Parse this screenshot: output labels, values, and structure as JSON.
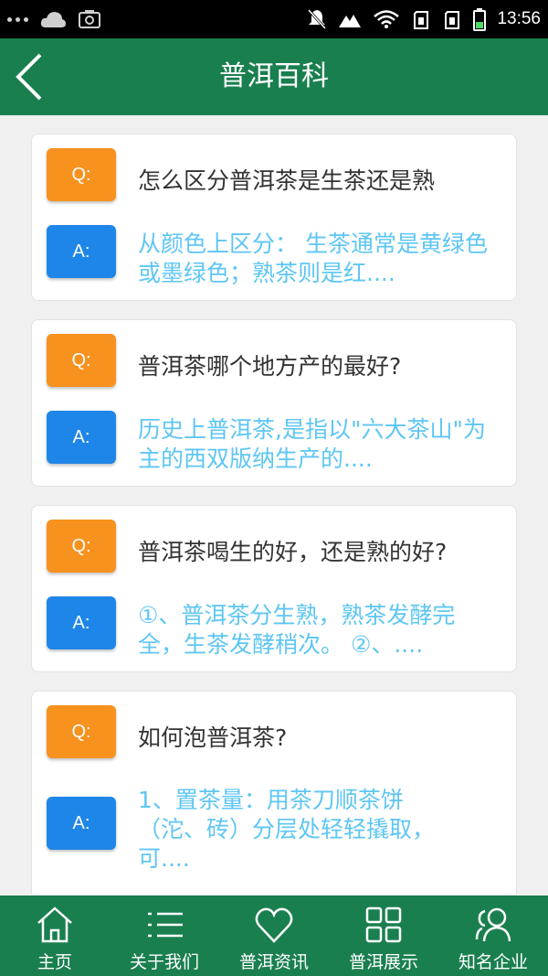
{
  "status_bar": {
    "time": "13:56",
    "icons": [
      "dots-icon",
      "cloud-icon",
      "screenshot-icon",
      "mute-icon",
      "signal-icon",
      "wifi-icon",
      "sim1-icon",
      "sim2-icon",
      "battery-icon"
    ]
  },
  "header": {
    "title": "普洱百科",
    "back_icon": "back-arrow-icon"
  },
  "qa": {
    "q_badge": "Q:",
    "a_badge": "A:",
    "items": [
      {
        "question": "怎么区分普洱茶是生茶还是熟",
        "answer": "从颜色上区分： 生茶通常是黄绿色或墨绿色；熟茶则是红...."
      },
      {
        "question": "普洱茶哪个地方产的最好?",
        "answer": "历史上普洱茶,是指以\"六大茶山\"为主的西双版纳生产的...."
      },
      {
        "question": "普洱茶喝生的好，还是熟的好?",
        "answer": "①、普洱茶分生熟，熟茶发酵完全，生茶发酵稍次。 ②、...."
      },
      {
        "question": "如何泡普洱茶?",
        "answer": "1、置茶量：用茶刀顺茶饼（沱、砖）分层处轻轻撬取，可...."
      }
    ]
  },
  "tabs": [
    {
      "label": "主页",
      "icon": "home-icon"
    },
    {
      "label": "关于我们",
      "icon": "list-icon"
    },
    {
      "label": "普洱资讯",
      "icon": "heart-icon"
    },
    {
      "label": "普洱展示",
      "icon": "grid-icon"
    },
    {
      "label": "知名企业",
      "icon": "users-icon"
    }
  ],
  "colors": {
    "primary": "#1a7f4f",
    "q_badge": "#f7921e",
    "a_badge": "#1e86e8",
    "answer_text": "#5ec6f3"
  }
}
